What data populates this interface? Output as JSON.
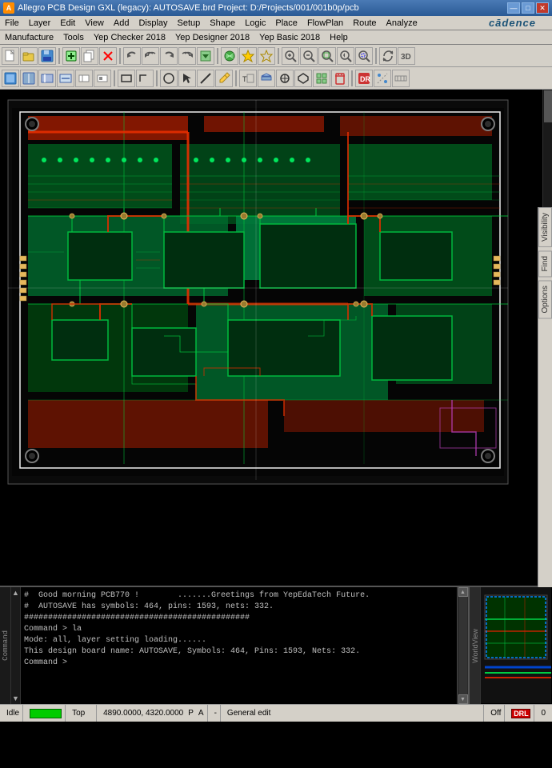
{
  "titleBar": {
    "title": "Allegro PCB Design GXL (legacy): AUTOSAVE.brd  Project: D:/Projects/001/001b0p/pcb",
    "winButtons": {
      "minimize": "—",
      "maximize": "□",
      "close": "✕"
    }
  },
  "menuBar1": {
    "items": [
      "File",
      "Layer",
      "Edit",
      "View",
      "Add",
      "Display",
      "Setup",
      "Shape",
      "Logic",
      "Place",
      "FlowPlan",
      "Route",
      "Analyze"
    ]
  },
  "menuBar2": {
    "items": [
      "Manufacture",
      "Tools",
      "Yep Checker 2018",
      "Yep Designer 2018",
      "Yep Basic 2018",
      "Help"
    ]
  },
  "cadenceLogo": "cādence",
  "sidePanel": {
    "buttons": [
      "Visibility",
      "Find",
      "Options"
    ]
  },
  "console": {
    "lines": [
      "#  Good morning PCB770 !        .......Greetings from YepEdaTech Future.",
      "#  AUTOSAVE has symbols: 464, pins: 1593, nets: 332.",
      "###############################################",
      "Command > la",
      "Mode: all, layer setting loading......",
      "This design board name: AUTOSAVE, Symbols: 464, Pins: 1593, Nets: 332.",
      "Command >"
    ],
    "prompt": "Command >"
  },
  "statusBar": {
    "idle": "Idle",
    "layer": "Top",
    "coordinates": "4890.0000, 4320.0000",
    "coordUnit1": "P",
    "coordUnit2": "A",
    "dash": "-",
    "mode": "General edit",
    "off": "Off",
    "indicator": "DRL",
    "number": "0"
  },
  "toolbar1": {
    "buttons": [
      "new",
      "open",
      "save",
      "add-connect",
      "copy",
      "delete",
      "undo",
      "undo2",
      "redo",
      "redo2",
      "down",
      "rat",
      "hilight",
      "dehilight",
      "zoom-in",
      "zoom-out",
      "zoom-fit",
      "zoom-prev",
      "zoom-area",
      "refresh",
      "3d"
    ]
  },
  "toolbar2": {
    "buttons": [
      "snap1",
      "snap2",
      "snap3",
      "snap4",
      "snap5",
      "snap6",
      "sep",
      "shape1",
      "shape2",
      "sep2",
      "circle",
      "pointer",
      "line",
      "pencil",
      "sep3",
      "icon1",
      "icon2",
      "icon3",
      "icon4",
      "icon5",
      "delete2",
      "sep4",
      "icon6",
      "rule1",
      "rule2"
    ]
  },
  "colors": {
    "background": "#000000",
    "pcbGreen": "#00cc44",
    "pcbRed": "#cc2200",
    "pcbBoard": "#1a1a1a",
    "menuBg": "#d4d0c8",
    "titleBg": "#2a5a95",
    "statusGreen": "#00cc00",
    "statusRed": "#cc0000"
  }
}
